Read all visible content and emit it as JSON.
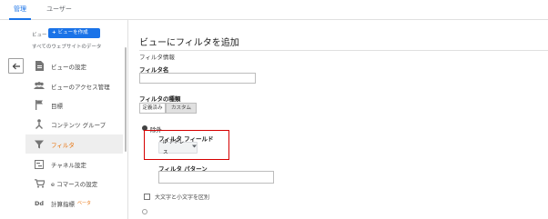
{
  "top_tabs": [
    "管理",
    "ユーザー"
  ],
  "sidebar": {
    "view_label": "ビュー",
    "create_view_button": "ビューを作成",
    "view_name": "すべてのウェブサイトのデータ",
    "items": [
      {
        "label": "ビューの設定",
        "icon": "document-icon"
      },
      {
        "label": "ビューのアクセス管理",
        "icon": "people-icon"
      },
      {
        "label": "目標",
        "icon": "flag-icon"
      },
      {
        "label": "コンテンツ グループ",
        "icon": "person-tree-icon"
      },
      {
        "label": "フィルタ",
        "icon": "filter-icon",
        "active": true
      },
      {
        "label": "チャネル設定",
        "icon": "channel-icon"
      },
      {
        "label": "e コマースの設定",
        "icon": "cart-icon"
      },
      {
        "label": "計算指標",
        "badge": "ベータ",
        "icon": "dd-icon"
      }
    ]
  },
  "main": {
    "title": "ビューにフィルタを追加",
    "section_title": "フィルタ情報",
    "filter_name_label": "フィルタ名",
    "filter_name_value": "",
    "filter_type_label": "フィルタの種類",
    "filter_type_options": [
      "定義済み",
      "カスタム"
    ],
    "filter_type_selected": "カスタム",
    "exclude_label": "除外",
    "filter_field_label": "フィルタ フィールド",
    "filter_field_value": "IP アドレス",
    "filter_pattern_label": "フィルタ パターン",
    "filter_pattern_value": "",
    "case_sensitive_label": "大文字と小文字を区別"
  },
  "colors": {
    "accent": "#1a73e8",
    "active_nav": "#e8710a",
    "highlight": "#d50000"
  }
}
